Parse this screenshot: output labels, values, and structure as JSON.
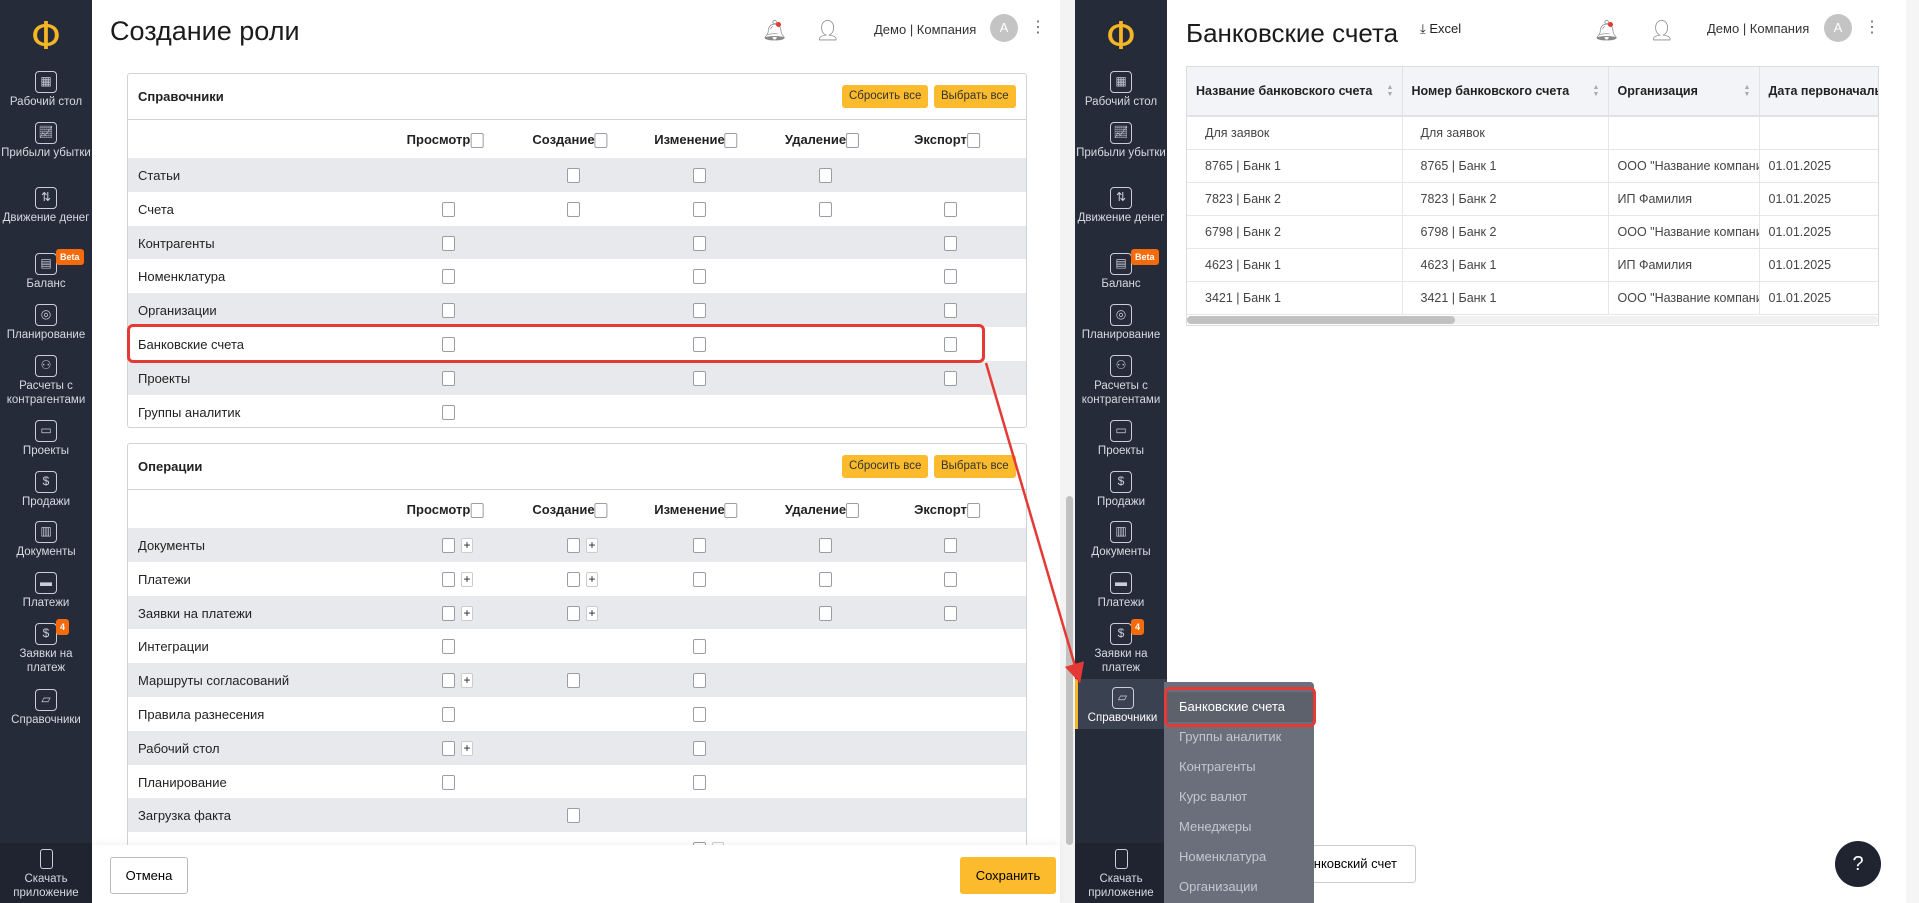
{
  "left": {
    "title": "Создание роли",
    "company": "Демо | Компания",
    "avatar": "A",
    "reset_label": "Сбросить все",
    "select_label": "Выбрать все",
    "columns": [
      "Просмотр",
      "Создание",
      "Изменение",
      "Удаление",
      "Экспорт"
    ],
    "cell_legend": "0 = none, 1 = checkbox, 2 = checkbox with plus",
    "sections": [
      {
        "title": "Справочники",
        "rows": [
          {
            "label": "Статьи",
            "cells": [
              0,
              1,
              1,
              1,
              0
            ]
          },
          {
            "label": "Счета",
            "cells": [
              1,
              1,
              1,
              1,
              1
            ]
          },
          {
            "label": "Контрагенты",
            "cells": [
              1,
              0,
              1,
              0,
              1
            ]
          },
          {
            "label": "Номенклатура",
            "cells": [
              1,
              0,
              1,
              0,
              1
            ]
          },
          {
            "label": "Организации",
            "cells": [
              1,
              0,
              1,
              0,
              1
            ]
          },
          {
            "label": "Банковские счета",
            "cells": [
              1,
              0,
              1,
              0,
              1
            ]
          },
          {
            "label": "Проекты",
            "cells": [
              1,
              0,
              1,
              0,
              1
            ]
          },
          {
            "label": "Группы аналитик",
            "cells": [
              1,
              0,
              0,
              0,
              0
            ]
          }
        ]
      },
      {
        "title": "Операции",
        "rows": [
          {
            "label": "Документы",
            "cells": [
              2,
              2,
              1,
              1,
              1
            ]
          },
          {
            "label": "Платежи",
            "cells": [
              2,
              2,
              1,
              1,
              1
            ]
          },
          {
            "label": "Заявки на платежи",
            "cells": [
              2,
              2,
              0,
              1,
              1
            ]
          },
          {
            "label": "Интеграции",
            "cells": [
              1,
              0,
              1,
              0,
              0
            ]
          },
          {
            "label": "Маршруты согласований",
            "cells": [
              2,
              1,
              1,
              0,
              0
            ]
          },
          {
            "label": "Правила разнесения",
            "cells": [
              1,
              0,
              1,
              0,
              0
            ]
          },
          {
            "label": "Рабочий стол",
            "cells": [
              2,
              0,
              1,
              0,
              0
            ]
          },
          {
            "label": "Планирование",
            "cells": [
              1,
              0,
              1,
              0,
              0
            ]
          },
          {
            "label": "Загрузка факта",
            "cells": [
              0,
              1,
              0,
              0,
              0
            ]
          },
          {
            "label": "",
            "cells": [
              0,
              0,
              2,
              0,
              0
            ]
          }
        ]
      }
    ],
    "cancel_label": "Отмена",
    "save_label": "Сохранить"
  },
  "sidebar": {
    "items": [
      {
        "label": "Рабочий стол",
        "icon": "dashboard-icon"
      },
      {
        "label": "Прибыли убытки",
        "icon": "chart-icon"
      },
      {
        "label": "Движение денег",
        "icon": "money-flow-icon"
      },
      {
        "label": "Баланс",
        "icon": "balance-icon",
        "badge": "Beta"
      },
      {
        "label": "Планирование",
        "icon": "target-icon"
      },
      {
        "label": "Расчеты с контрагентами",
        "icon": "people-icon"
      },
      {
        "label": "Проекты",
        "icon": "briefcase-icon"
      },
      {
        "label": "Продажи",
        "icon": "dollar-icon"
      },
      {
        "label": "Документы",
        "icon": "documents-icon"
      },
      {
        "label": "Платежи",
        "icon": "wallet-icon"
      },
      {
        "label": "Заявки на платеж",
        "icon": "invoice-icon",
        "badge": "4"
      },
      {
        "label": "Справочники",
        "icon": "folder-icon"
      }
    ],
    "download_label": "Скачать приложение"
  },
  "right": {
    "title": "Банковские счета",
    "excel_label": "Excel",
    "company": "Демо | Компания",
    "avatar": "A",
    "columns": [
      "Название банковского счета",
      "Номер банковского счета",
      "Организация",
      "Дата первоначаль"
    ],
    "rows": [
      [
        "Для заявок",
        "Для заявок",
        "",
        ""
      ],
      [
        "8765 | Банк 1",
        "8765 | Банк 1",
        "ООО \"Название компани",
        "01.01.2025"
      ],
      [
        "7823 | Банк 2",
        "7823 | Банк 2",
        "ИП Фамилия",
        "01.01.2025"
      ],
      [
        "6798 | Банк 2",
        "6798 | Банк 2",
        "ООО \"Название компани",
        "01.01.2025"
      ],
      [
        "4623 | Банк 1",
        "4623 | Банк 1",
        "ИП Фамилия",
        "01.01.2025"
      ],
      [
        "3421 | Банк 1",
        "3421 | Банк 1",
        "ООО \"Название компани",
        "01.01.2025"
      ]
    ],
    "add_label": "Добавить банковский счет",
    "flyout": [
      "Банковские счета",
      "Группы аналитик",
      "Контрагенты",
      "Курс валют",
      "Менеджеры",
      "Номенклатура",
      "Организации"
    ],
    "help": "?"
  },
  "colors": {
    "accent": "#fbbb2c",
    "sidebar": "#252b38",
    "highlight": "#e53935"
  }
}
